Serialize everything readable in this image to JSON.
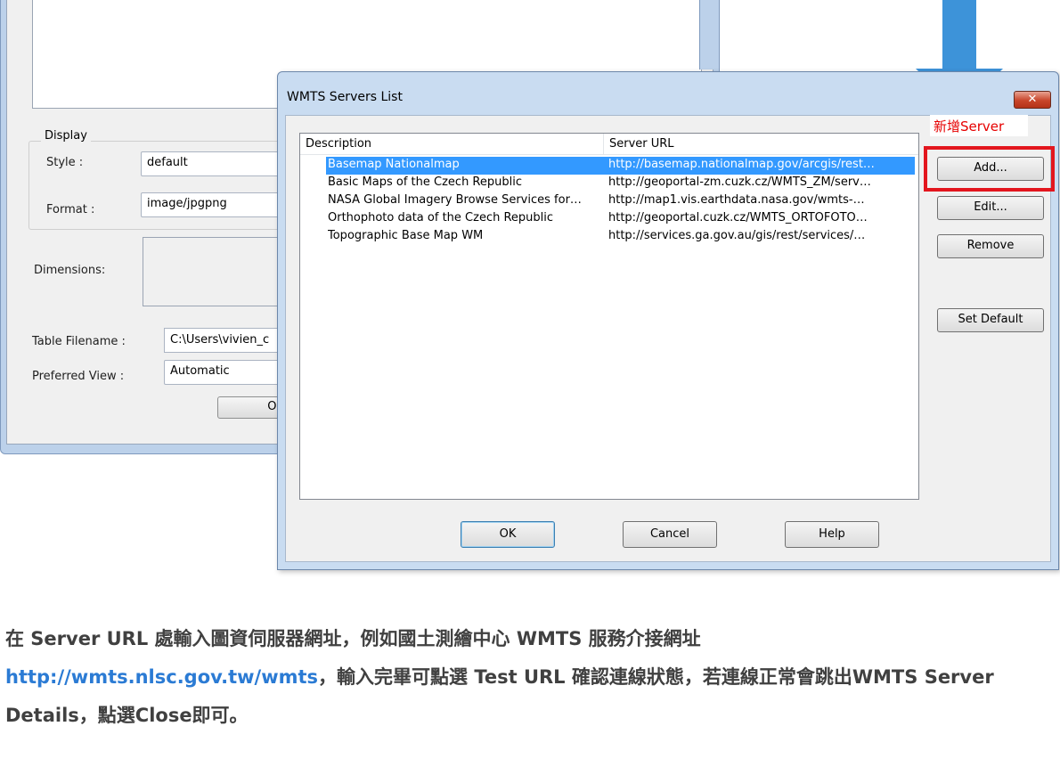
{
  "background_window": {
    "display_group_label": "Display",
    "style_label": "Style :",
    "style_value": "default",
    "format_label": "Format :",
    "format_value": "image/jpgpng",
    "dimensions_label": "Dimensions:",
    "table_filename_label": "Table Filename :",
    "table_filename_value": "C:\\Users\\vivien_c",
    "preferred_view_label": "Preferred View :",
    "preferred_view_value": "Automatic",
    "ok_label": "OK"
  },
  "dialog": {
    "title": "WMTS Servers List",
    "close_glyph": "✕",
    "columns": [
      "Description",
      "Server URL"
    ],
    "rows": [
      {
        "description": "Basemap Nationalmap",
        "url": "http://basemap.nationalmap.gov/arcgis/rest…",
        "selected": true
      },
      {
        "description": "Basic Maps of the Czech Republic",
        "url": "http://geoportal-zm.cuzk.cz/WMTS_ZM/serv…"
      },
      {
        "description": "NASA Global Imagery Browse Services for…",
        "url": "http://map1.vis.earthdata.nasa.gov/wmts-…"
      },
      {
        "description": "Orthophoto data of the Czech Republic",
        "url": "http://geoportal.cuzk.cz/WMTS_ORTOFOTO…"
      },
      {
        "description": "Topographic Base Map WM",
        "url": "http://services.ga.gov.au/gis/rest/services/…"
      }
    ],
    "buttons": {
      "add": "Add...",
      "edit": "Edit...",
      "remove": "Remove",
      "set_default": "Set Default",
      "ok": "OK",
      "cancel": "Cancel",
      "help": "Help"
    }
  },
  "annotation": {
    "label": "新增Server",
    "color": "#e60000"
  },
  "caption": {
    "part1": "在 Server URL 處輸入圖資伺服器網址，例如國土測繪中心 WMTS 服務介接網址",
    "url": "http://wmts.nlsc.gov.tw/wmts",
    "part2": "，輸入完畢可點選 Test URL 確認連線狀態，若連線正常會跳出WMTS Server Details，點選Close即可。"
  },
  "colors": {
    "selection": "#3399ff",
    "arrow": "#3d93d9",
    "highlight_rect": "#e3161e",
    "caption_text": "#404040",
    "caption_url": "#2b7bd4"
  }
}
